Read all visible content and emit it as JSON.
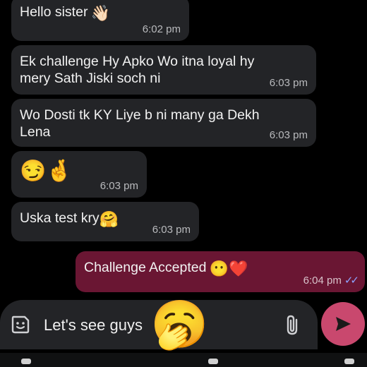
{
  "messages": [
    {
      "text": "Hello sister",
      "emoji": "👋🏻",
      "time": "6:02 pm"
    },
    {
      "text": "Ek challenge Hy Apko Wo itna loyal hy mery Sath Jiski soch ni",
      "time": "6:03 pm"
    },
    {
      "text": "Wo Dosti tk KY Liye b ni many ga Dekh Lena",
      "time": "6:03 pm"
    },
    {
      "emoji": "😏🤞",
      "time": "6:03 pm"
    },
    {
      "text": "Uska test kry",
      "emoji": "🤗",
      "time": "6:03 pm"
    },
    {
      "text": "Challenge Accepted",
      "emoji": "😶❤️",
      "time": "6:04 pm",
      "status": "✓✓"
    }
  ],
  "composer": {
    "value": "Let's see guys",
    "overlay_emoji": "🥱"
  },
  "icons": {
    "sticker": "sticker-icon",
    "attach": "paperclip-icon",
    "send": "send-arrow-icon"
  },
  "colors": {
    "background": "#000000",
    "incoming_bubble": "#232427",
    "outgoing_bubble": "#6a1633",
    "send_button": "#c9486e",
    "read_ticks": "#8ea3ff"
  }
}
